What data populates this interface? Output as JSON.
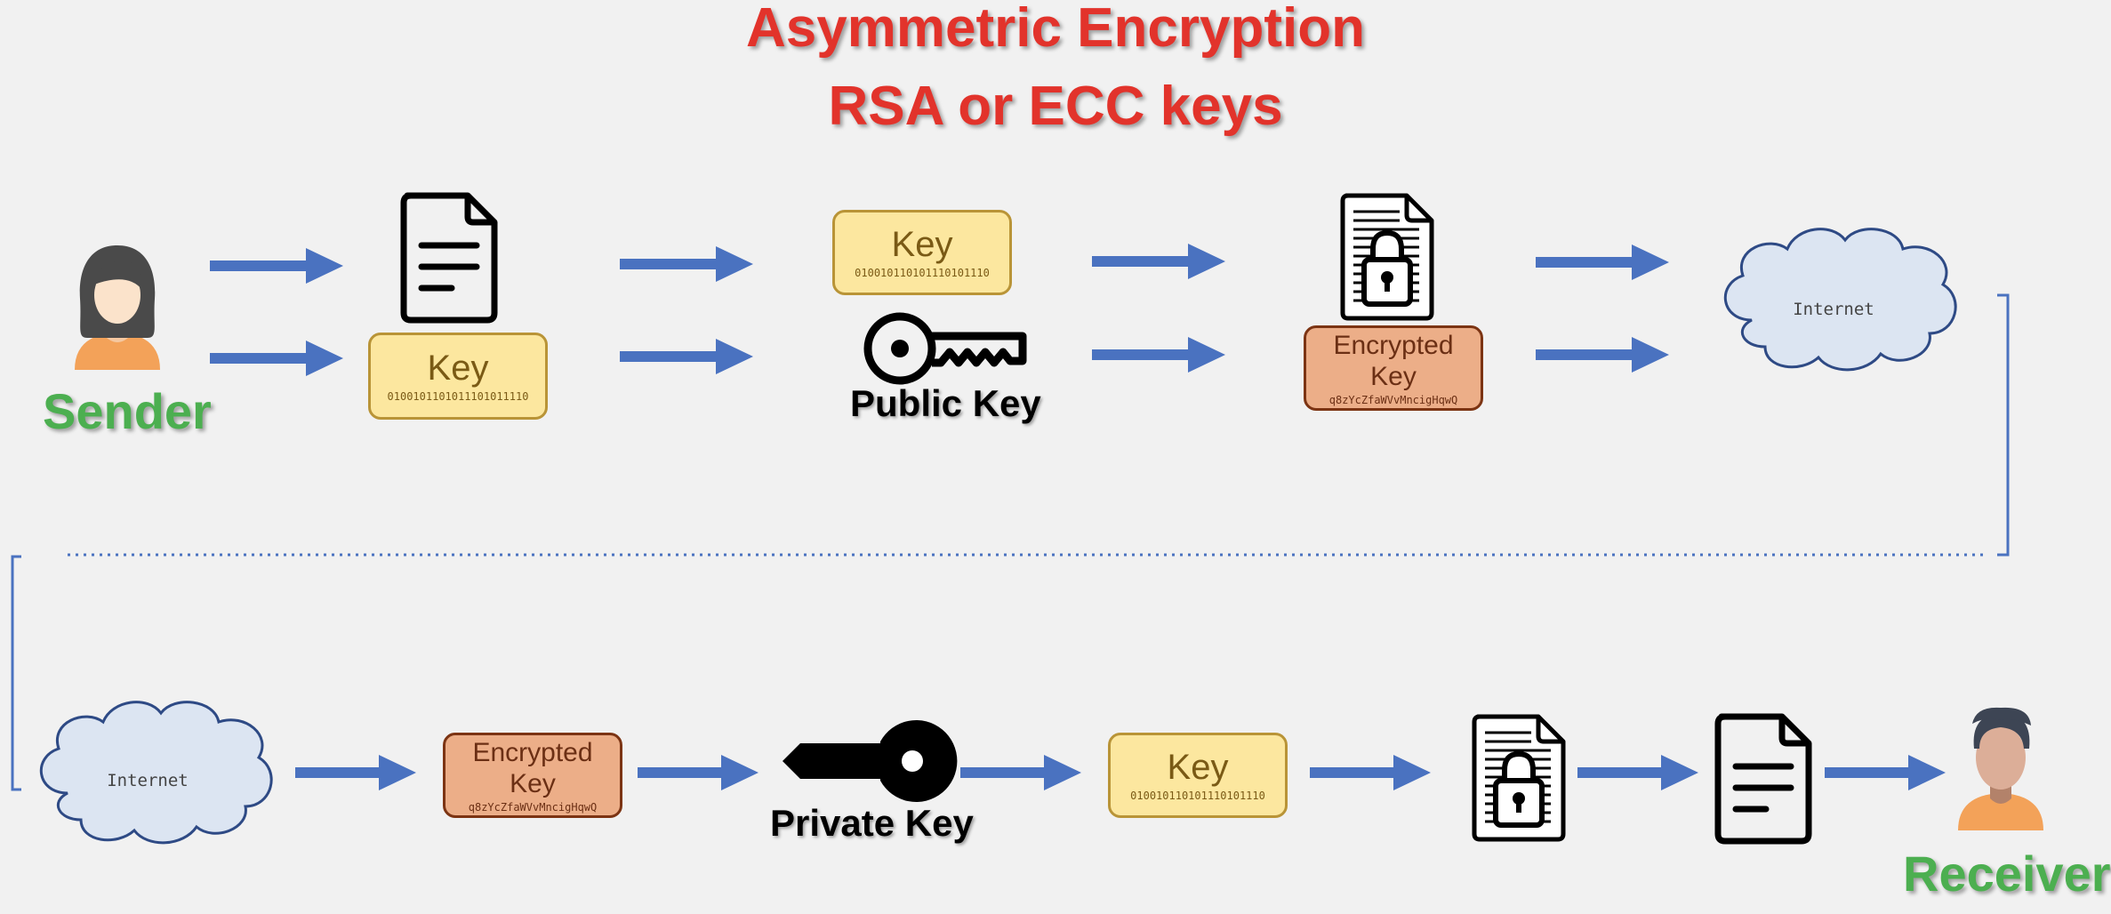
{
  "title": {
    "line1": "Asymmetric Encryption",
    "line2": "RSA or ECC keys"
  },
  "sender": {
    "label": "Sender"
  },
  "receiver": {
    "label": "Receiver"
  },
  "key_box": {
    "label": "Key",
    "bits": "0100101101011101011110"
  },
  "key_box_2": {
    "label": "Key",
    "bits": "010010110101110101110"
  },
  "encrypted_key": {
    "label": "Encrypted Key",
    "line1": "Encrypted",
    "line2": "Key",
    "cipher": "q8zYcZfaWVvMncigHqwQ"
  },
  "public_key": {
    "label": "Public Key"
  },
  "private_key": {
    "label": "Private Key"
  },
  "internet": {
    "label": "Internet"
  },
  "colors": {
    "title": "#e2332b",
    "role": "#4caf50",
    "arrow": "#4a72c0",
    "plain_key_fill": "#fce79f",
    "encrypted_key_fill": "#ecae88",
    "cloud_fill": "#dce5f2"
  }
}
